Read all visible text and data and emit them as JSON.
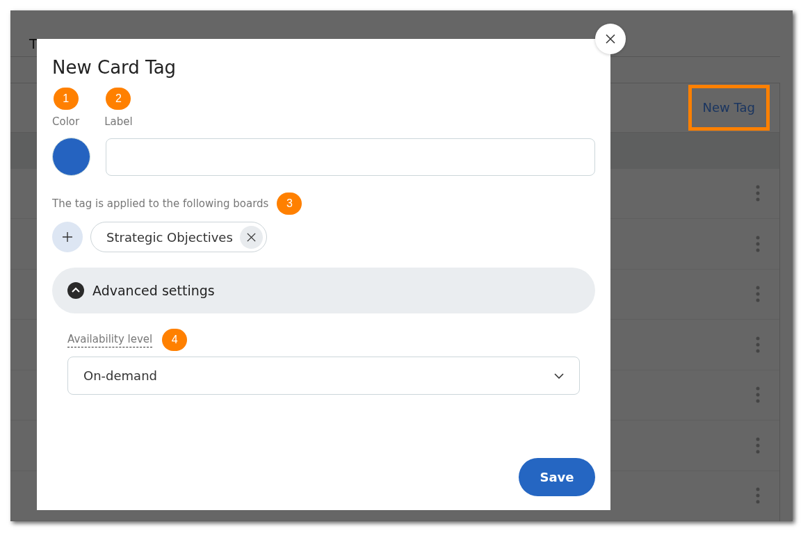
{
  "background": {
    "title": "T",
    "new_tag_button": "New Tag",
    "rows": [
      {},
      {},
      {},
      {},
      {},
      {},
      {}
    ]
  },
  "dialog": {
    "title": "New Card Tag",
    "fields": [
      {
        "label": "Color",
        "badge": "1"
      },
      {
        "label": "Label",
        "badge": "2"
      }
    ],
    "color": "#2563c0",
    "boards_label": "The tag is applied to the following boards",
    "boards_badge": "3",
    "boards": [
      "Strategic Objectives"
    ],
    "advanced": {
      "title": "Advanced settings",
      "expanded": true
    },
    "availability": {
      "label": "Availability level",
      "badge": "4",
      "value": "On-demand"
    },
    "save": "Save"
  }
}
